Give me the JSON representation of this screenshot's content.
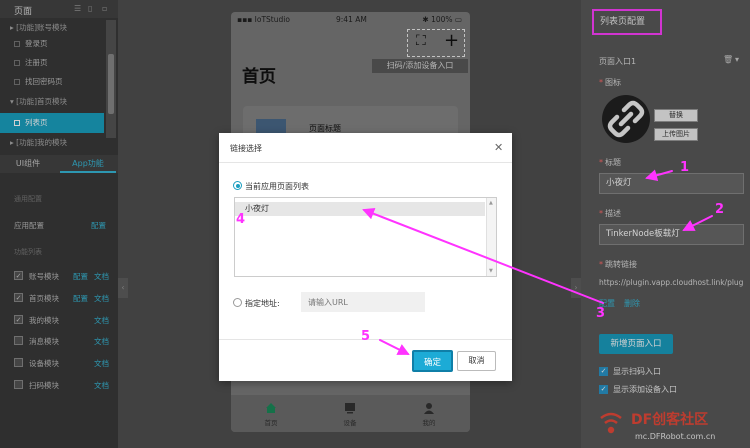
{
  "sidebar": {
    "title": "页面",
    "pages": [
      {
        "label": "[功能]账号模块",
        "type": "group"
      },
      {
        "label": "登录页",
        "type": "item"
      },
      {
        "label": "注册页",
        "type": "item"
      },
      {
        "label": "找回密码页",
        "type": "item"
      },
      {
        "label": "[功能]首页模块",
        "type": "group"
      },
      {
        "label": "列表页",
        "type": "item",
        "active": true
      },
      {
        "label": "[功能]我的模块",
        "type": "group"
      }
    ],
    "tabs": [
      "UI组件",
      "App功能"
    ],
    "general_title": "通用配置",
    "app_config": {
      "label": "应用配置",
      "link": "配置"
    },
    "module_title": "功能列表",
    "modules": [
      {
        "label": "账号模块",
        "checked": true,
        "config": "配置",
        "doc": "文档"
      },
      {
        "label": "首页模块",
        "checked": true,
        "config": "配置",
        "doc": "文档"
      },
      {
        "label": "我的模块",
        "checked": true,
        "config": "",
        "doc": "文档"
      },
      {
        "label": "消息模块",
        "checked": false,
        "config": "",
        "doc": "文档"
      },
      {
        "label": "设备模块",
        "checked": false,
        "config": "",
        "doc": "文档"
      },
      {
        "label": "扫码模块",
        "checked": false,
        "config": "",
        "doc": "文档"
      }
    ]
  },
  "phone": {
    "carrier": "IoTStudio",
    "time": "9:41 AM",
    "battery": "100%",
    "scan_tip": "扫码/添加设备入口",
    "home_title": "首页",
    "card_title": "页面标题",
    "tabbar": [
      {
        "label": "首页",
        "icon": "home-icon"
      },
      {
        "label": "设备",
        "icon": "device-icon"
      },
      {
        "label": "我的",
        "icon": "user-icon"
      }
    ]
  },
  "right_panel": {
    "title": "列表页配置",
    "entry_label": "页面入口1",
    "icon_label": "图标",
    "replace_btn": "替换",
    "upload_btn": "上传图片",
    "title_label": "标题",
    "title_value": "小夜灯",
    "desc_label": "描述",
    "desc_value": "TinkerNode板载灯",
    "link_label": "跳转链接",
    "link_value": "https://plugin.vapp.cloudhost.link/plug",
    "config_link": "配置",
    "delete_link": "删除",
    "new_entry_btn": "新增页面入口",
    "show_scan": "显示扫码入口",
    "show_add_device": "显示添加设备入口"
  },
  "modal": {
    "title": "链接选择",
    "option_current": "当前应用页面列表",
    "list_items": [
      "小夜灯"
    ],
    "option_custom": "指定地址:",
    "url_placeholder": "请输入URL",
    "ok": "确定",
    "cancel": "取消"
  },
  "annotations": [
    "1",
    "2",
    "3",
    "4",
    "5"
  ],
  "watermark": {
    "brand": "DF创客社区",
    "url": "mc.DFRobot.com.cn"
  },
  "colors": {
    "accent": "#1aa1c1",
    "annotation": "#ff33ff",
    "primary_button": "#1cabd6"
  }
}
